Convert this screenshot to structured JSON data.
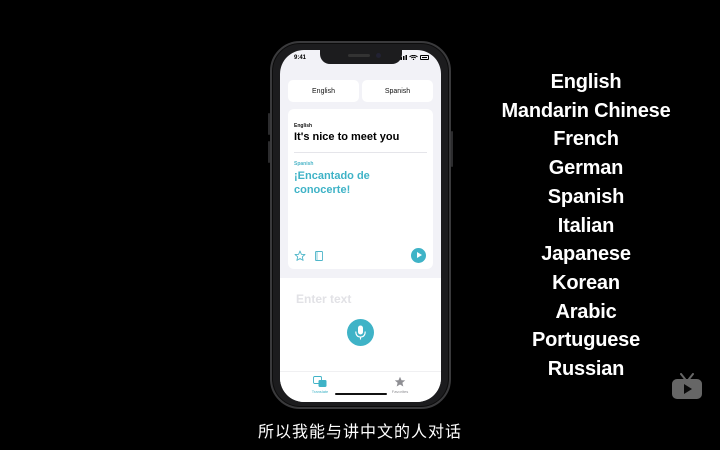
{
  "phone": {
    "status_time": "9:41",
    "languages": {
      "source": "English",
      "target": "Spanish"
    },
    "card": {
      "source_label": "English",
      "source_text": "It's nice to meet you",
      "target_label": "Spanish",
      "target_text": "¡Encantado de conocerte!"
    },
    "input_placeholder": "Enter text",
    "tabs": [
      {
        "label": "Translate",
        "icon": "translate-icon",
        "active": true
      },
      {
        "label": "Favorites",
        "icon": "star-icon",
        "active": false
      }
    ],
    "accent_color": "#3fb3c7"
  },
  "supported_languages": [
    "English",
    "Mandarin Chinese",
    "French",
    "German",
    "Spanish",
    "Italian",
    "Japanese",
    "Korean",
    "Arabic",
    "Portuguese",
    "Russian"
  ],
  "subtitle": "所以我能与讲中文的人对话",
  "watermark_icon": "tv-icon"
}
